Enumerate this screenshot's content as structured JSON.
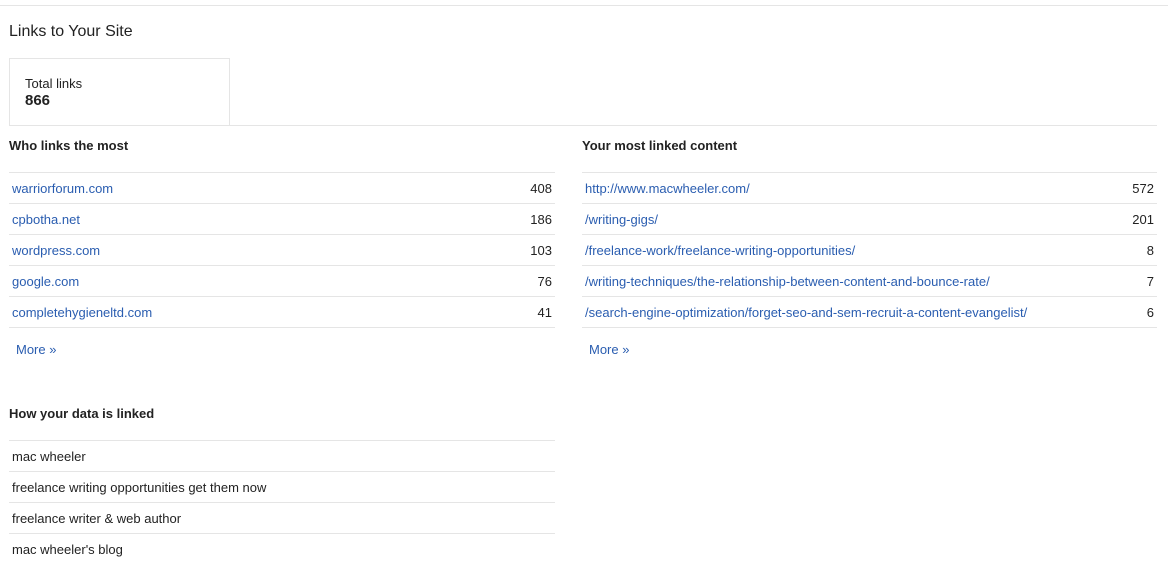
{
  "page_title": "Links to Your Site",
  "total_links": {
    "label": "Total links",
    "value": "866"
  },
  "who_links": {
    "title": "Who links the most",
    "rows": [
      {
        "domain": "warriorforum.com",
        "count": "408"
      },
      {
        "domain": "cpbotha.net",
        "count": "186"
      },
      {
        "domain": "wordpress.com",
        "count": "103"
      },
      {
        "domain": "google.com",
        "count": "76"
      },
      {
        "domain": "completehygieneltd.com",
        "count": "41"
      }
    ],
    "more_label": "More »"
  },
  "linked_content": {
    "title": "Your most linked content",
    "rows": [
      {
        "path": "http://www.macwheeler.com/",
        "count": "572"
      },
      {
        "path": "/writing-gigs/",
        "count": "201"
      },
      {
        "path": "/freelance-work/freelance-writing-opportunities/",
        "count": "8"
      },
      {
        "path": "/writing-techniques/the-relationship-between-content-and-bounce-rate/",
        "count": "7"
      },
      {
        "path": "/search-engine-optimization/forget-seo-and-sem-recruit-a-content-evangelist/",
        "count": "6"
      }
    ],
    "more_label": "More »"
  },
  "data_linked": {
    "title": "How your data is linked",
    "rows": [
      "mac wheeler",
      "freelance writing opportunities get them now",
      "freelance writer & web author",
      "mac wheeler's blog"
    ]
  },
  "colors": {
    "link": "#2a5db0",
    "text": "#222222",
    "rule": "#e5e5e5"
  }
}
